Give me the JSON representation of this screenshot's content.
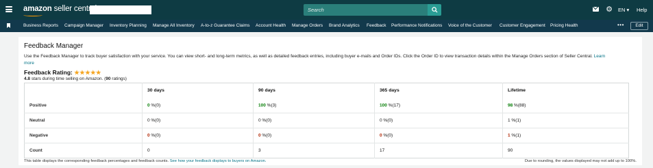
{
  "topbar": {
    "logo_text": "amazon",
    "logo_sub": " seller central",
    "search_placeholder": "Search",
    "language": "EN ▾",
    "help": "Help"
  },
  "nav": {
    "items": [
      "Business Reports",
      "Campaign Manager",
      "Inventory Planning",
      "Manage All Inventory",
      "A-to-z Guarantee Claims",
      "Account Health",
      "Manage Orders",
      "Brand Analytics",
      "Feedback",
      "Performance Notifications",
      "Voice of the Customer",
      "Customer Engagement",
      "Pricing Health"
    ],
    "more": "•••",
    "edit": "Edit"
  },
  "page": {
    "title": "Feedback Manager",
    "description": "Use the Feedback Manager to track buyer satisfaction with your service. You can view short- and long-term metrics, as well as detailed feedback entries, including buyer e-mails and Order IDs. Click the Order ID to view transaction details within the Manage Orders section of Seller Central.",
    "learn_more": "Learn more",
    "rating_label": "Feedback Rating:",
    "stars": "★★★★★",
    "stars_value": 4.8,
    "rating_value": "4.8",
    "rating_text_mid": " stars during time selling on Amazon. (",
    "rating_count": "90",
    "rating_text_end": " ratings)"
  },
  "table": {
    "headers": [
      "",
      "30 days",
      "90 days",
      "365 days",
      "Lifetime"
    ],
    "rows": [
      {
        "label": "Positive",
        "cells": [
          [
            "0",
            " %(0)"
          ],
          [
            "100",
            " %(3)"
          ],
          [
            "100",
            " %(17)"
          ],
          [
            "98",
            " %(88)"
          ]
        ]
      },
      {
        "label": "Neutral",
        "cells": [
          [
            "0",
            " %(0)"
          ],
          [
            "0",
            " %(0)"
          ],
          [
            "0",
            " %(0)"
          ],
          [
            "1",
            " %(1)"
          ]
        ]
      },
      {
        "label": "Negative",
        "cells": [
          [
            "0",
            " %(0)"
          ],
          [
            "0",
            " %(0)"
          ],
          [
            "0",
            " %(0)"
          ],
          [
            "1",
            " %(1)"
          ]
        ]
      },
      {
        "label": "Count",
        "cells": [
          [
            "0",
            ""
          ],
          [
            "3",
            ""
          ],
          [
            "17",
            ""
          ],
          [
            "90",
            ""
          ]
        ]
      }
    ]
  },
  "footer": {
    "left_text": "This table displays the corresponding feedback percentages and feedback counts. ",
    "left_link": "See how your feedback displays to buyers on Amazon.",
    "right_text": "Due to rounding, the values displayed may not add up to 100%."
  },
  "colors": {
    "topbar": "#0e3b43",
    "navbar": "#12394c",
    "positive": "#067d06",
    "negative": "#b12704",
    "link": "#007185",
    "star": "#f5a623"
  },
  "icons": [
    "hamburger-icon",
    "search-icon",
    "mail-icon",
    "gear-icon",
    "bookmark-icon"
  ]
}
